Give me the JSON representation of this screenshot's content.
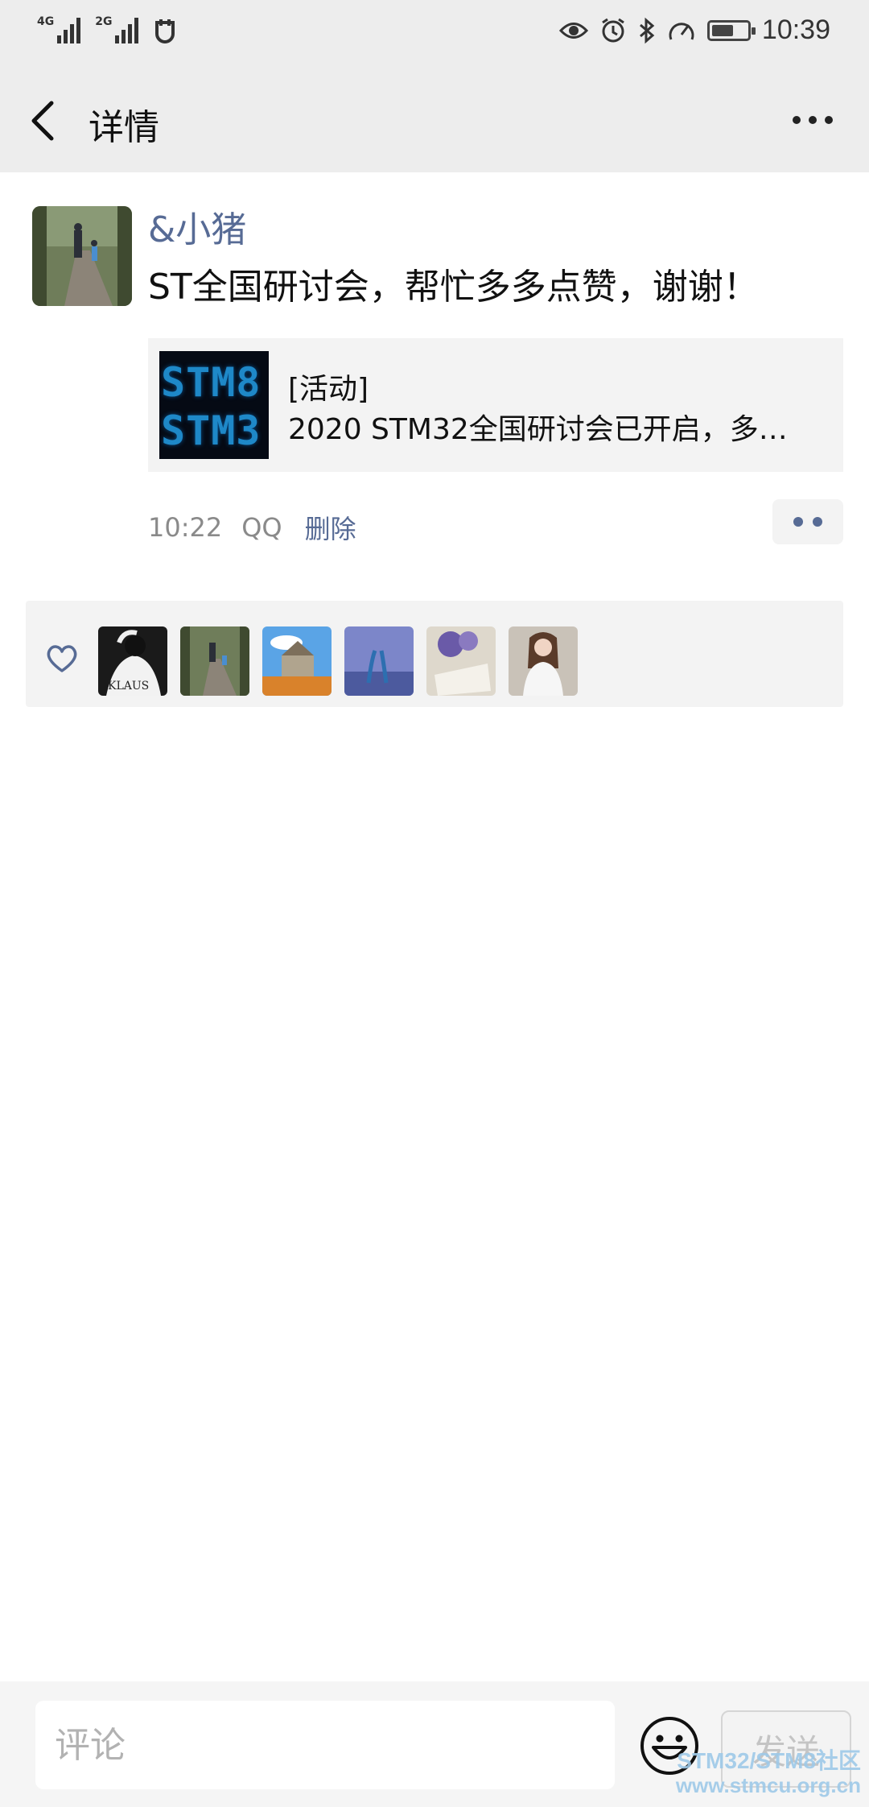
{
  "status_bar": {
    "network_1": "4G",
    "network_2": "2G",
    "time": "10:39",
    "battery_level": 0.55,
    "icons": [
      "eye-icon",
      "alarm-icon",
      "bluetooth-icon",
      "speedometer-icon",
      "battery-icon"
    ]
  },
  "nav": {
    "title": "详情",
    "back_icon": "chevron-left-icon",
    "more_icon": "more-dots-icon"
  },
  "post": {
    "author": "&小猪",
    "text": "ST全国研讨会，帮忙多多点赞，谢谢！",
    "link": {
      "thumb_line1": "STM8",
      "thumb_line2": "STM3",
      "tag": "[活动]",
      "title": "2020 STM32全国研讨会已开启，多…"
    },
    "time": "10:22",
    "source": "QQ",
    "delete_label": "删除"
  },
  "likes": {
    "heart_icon": "heart-outline-icon",
    "liker_avatar_texts": [
      "KLAUS"
    ],
    "count": 6
  },
  "comment_bar": {
    "placeholder": "评论",
    "emoji_icon": "smiley-icon",
    "send_label": "发送"
  },
  "watermark": {
    "line1": "STM32/STM8社区",
    "line2": "www.stmcu.org.cn"
  },
  "colors": {
    "link_blue": "#576b95",
    "header_bg": "#ededed",
    "card_bg": "#f3f3f3"
  }
}
